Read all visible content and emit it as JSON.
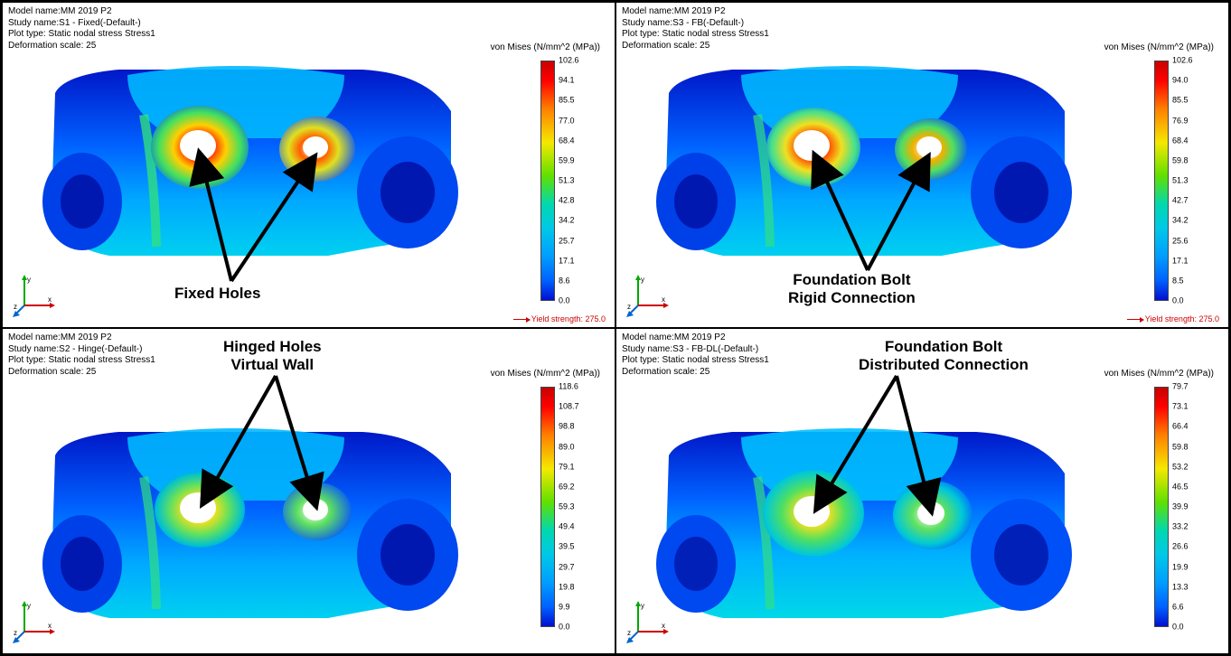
{
  "common": {
    "model_name_label": "Model name:",
    "study_name_label": "Study name:",
    "plot_type_label": "Plot type:",
    "def_scale_label": "Deformation scale:",
    "model_name": "MM 2019 P2",
    "plot_type": "Static nodal stress Stress1",
    "def_scale": "25",
    "legend_title": "von Mises (N/mm^2 (MPa))",
    "yield_label": "Yield strength:",
    "yield_value": "275.0"
  },
  "panels": [
    {
      "id": "top-left",
      "study": "S1 - Fixed(-Default-)",
      "annotation_lines": [
        "Fixed Holes"
      ],
      "show_yield": true,
      "ticks": [
        "102.6",
        "94.1",
        "85.5",
        "77.0",
        "68.4",
        "59.9",
        "51.3",
        "42.8",
        "34.2",
        "25.7",
        "17.1",
        "8.6",
        "0.0"
      ],
      "annotation_pos": "bottom",
      "arrow_variant": "up"
    },
    {
      "id": "top-right",
      "study": "S3 - FB(-Default-)",
      "annotation_lines": [
        "Foundation Bolt",
        "Rigid Connection"
      ],
      "show_yield": true,
      "ticks": [
        "102.6",
        "94.0",
        "85.5",
        "76.9",
        "68.4",
        "59.8",
        "51.3",
        "42.7",
        "34.2",
        "25.6",
        "17.1",
        "8.5",
        "0.0"
      ],
      "annotation_pos": "bottom",
      "arrow_variant": "up"
    },
    {
      "id": "bottom-left",
      "study": "S2 - Hinge(-Default-)",
      "annotation_lines": [
        "Hinged Holes",
        "Virtual Wall"
      ],
      "show_yield": false,
      "ticks": [
        "118.6",
        "108.7",
        "98.8",
        "89.0",
        "79.1",
        "69.2",
        "59.3",
        "49.4",
        "39.5",
        "29.7",
        "19.8",
        "9.9",
        "0.0"
      ],
      "annotation_pos": "top",
      "arrow_variant": "down"
    },
    {
      "id": "bottom-right",
      "study": "S3 - FB-DL(-Default-)",
      "annotation_lines": [
        "Foundation Bolt",
        "Distributed Connection"
      ],
      "show_yield": false,
      "ticks": [
        "79.7",
        "73.1",
        "66.4",
        "59.8",
        "53.2",
        "46.5",
        "39.9",
        "33.2",
        "26.6",
        "19.9",
        "13.3",
        "6.6",
        "0.0"
      ],
      "annotation_pos": "top",
      "arrow_variant": "down"
    }
  ]
}
